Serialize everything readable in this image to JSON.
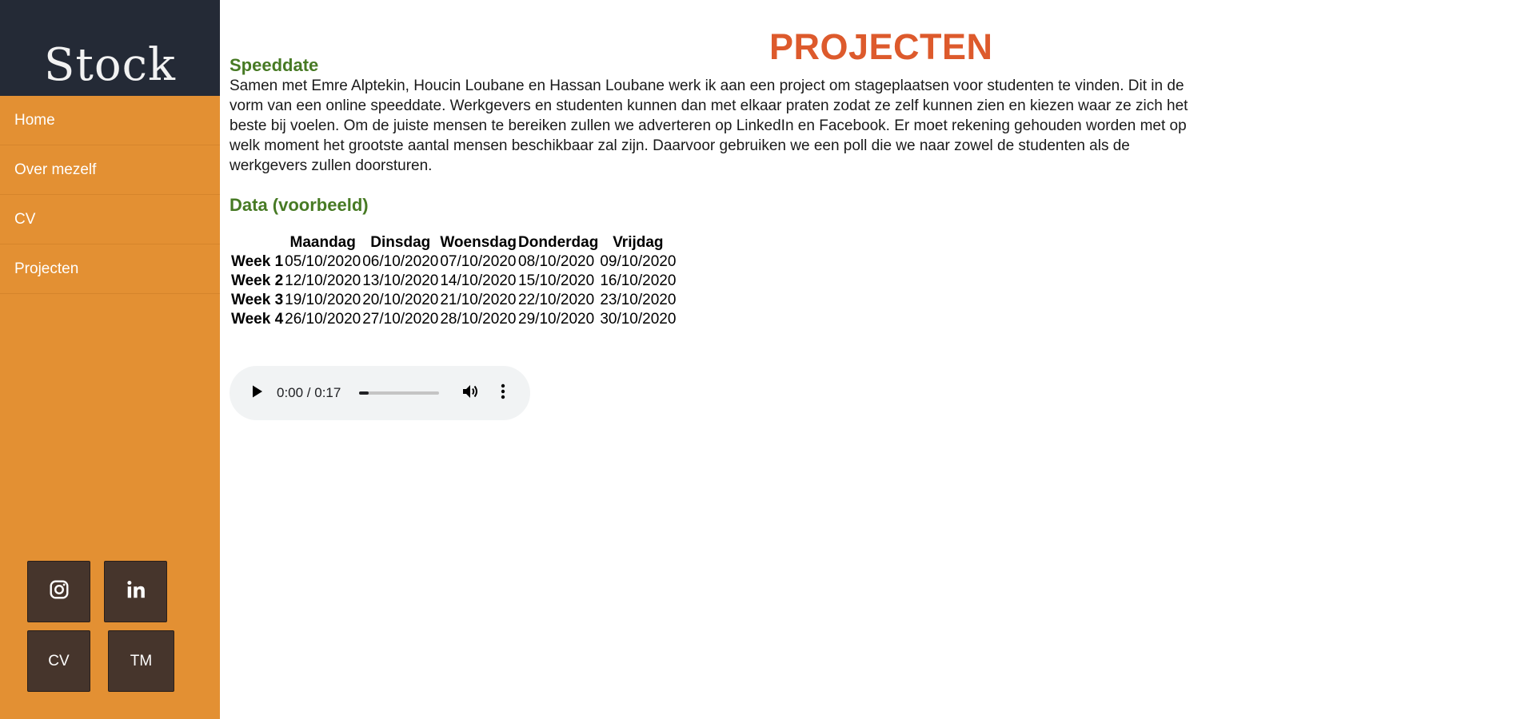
{
  "sidebar": {
    "logo": "Stock",
    "nav": [
      {
        "label": "Home"
      },
      {
        "label": "Over mezelf"
      },
      {
        "label": "CV"
      },
      {
        "label": "Projecten"
      }
    ],
    "social": {
      "instagram_icon": "instagram-icon",
      "linkedin_icon": "linkedin-icon",
      "cv_label": "CV",
      "tm_label": "TM"
    },
    "colors": {
      "sidebar_bg": "#e39033",
      "logo_bg": "#242a36",
      "button_bg": "#46352c"
    }
  },
  "main": {
    "title": "PROJECTEN",
    "section1": {
      "heading": "Speeddate",
      "text": "Samen met Emre Alptekin, Houcin Loubane en Hassan Loubane werk ik aan een project om stageplaatsen voor studenten te vinden. Dit in de vorm van een online speeddate. Werkgevers en studenten kunnen dan met elkaar praten zodat ze zelf kunnen zien en kiezen waar ze zich het beste bij voelen. Om de juiste mensen te bereiken zullen we adverteren op LinkedIn en Facebook. Er moet rekening gehouden worden met op welk moment het grootste aantal mensen beschikbaar zal zijn. Daarvoor gebruiken we een poll die we naar zowel de studenten als de werkgevers zullen doorsturen."
    },
    "section2": {
      "heading": "Data (voorbeeld)",
      "table": {
        "headers": [
          "",
          "Maandag",
          "Dinsdag",
          "Woensdag",
          "Donderdag",
          "Vrijdag"
        ],
        "rows": [
          {
            "week": "Week 1",
            "cells": [
              "05/10/2020",
              "06/10/2020",
              "07/10/2020",
              "08/10/2020",
              "09/10/2020"
            ]
          },
          {
            "week": "Week 2",
            "cells": [
              "12/10/2020",
              "13/10/2020",
              "14/10/2020",
              "15/10/2020",
              "16/10/2020"
            ]
          },
          {
            "week": "Week 3",
            "cells": [
              "19/10/2020",
              "20/10/2020",
              "21/10/2020",
              "22/10/2020",
              "23/10/2020"
            ]
          },
          {
            "week": "Week 4",
            "cells": [
              "26/10/2020",
              "27/10/2020",
              "28/10/2020",
              "29/10/2020",
              "30/10/2020"
            ]
          }
        ]
      }
    },
    "audio": {
      "time": "0:00 / 0:17",
      "progress": 0.12,
      "play_icon": "play-icon",
      "volume_icon": "volume-icon",
      "more_icon": "more-vert-icon"
    },
    "colors": {
      "title": "#dd5a2c",
      "heading": "#477a24"
    }
  }
}
